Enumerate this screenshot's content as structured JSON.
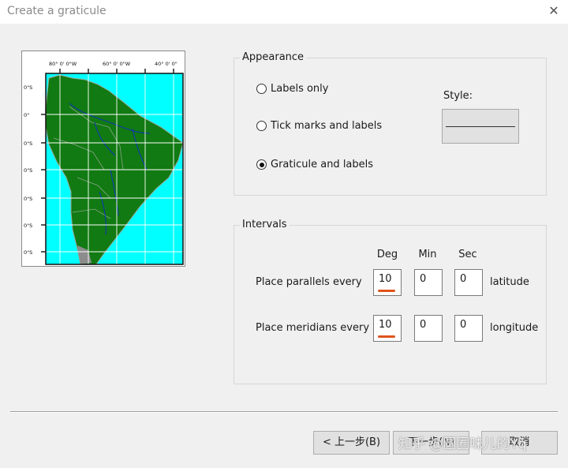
{
  "window": {
    "title": "Create a graticule",
    "close_glyph": "✕"
  },
  "preview": {
    "top_labels": [
      "80° 0' 0\"W",
      "60° 0' 0\"W",
      "40° 0' 0\""
    ],
    "left_labels": [
      "0\"S",
      "0\"",
      "0\"S",
      "0\"S",
      "0\"S",
      "0\"S",
      "0\"S"
    ],
    "colors": {
      "ocean": "#00ffff",
      "land": "#117a12",
      "rivers": "#1030c0",
      "grid": "#ffffff"
    }
  },
  "appearance": {
    "legend": "Appearance",
    "options": [
      {
        "label": "Labels only",
        "checked": false
      },
      {
        "label": "Tick marks and labels",
        "checked": false
      },
      {
        "label": "Graticule and labels",
        "checked": true
      }
    ],
    "style_label": "Style:"
  },
  "intervals": {
    "legend": "Intervals",
    "headers": [
      "Deg",
      "Min",
      "Sec"
    ],
    "rows": [
      {
        "label": "Place parallels every",
        "deg": "10",
        "min": "0",
        "sec": "0",
        "unit": "latitude"
      },
      {
        "label": "Place meridians every",
        "deg": "10",
        "min": "0",
        "sec": "0",
        "unit": "longitude"
      }
    ],
    "highlight_color": "#e0541b"
  },
  "buttons": {
    "back": "< 上一步(B)",
    "next": "下一步(N)",
    "cancel": "取消"
  },
  "watermark": "知乎 @圆圈味儿的Yq"
}
